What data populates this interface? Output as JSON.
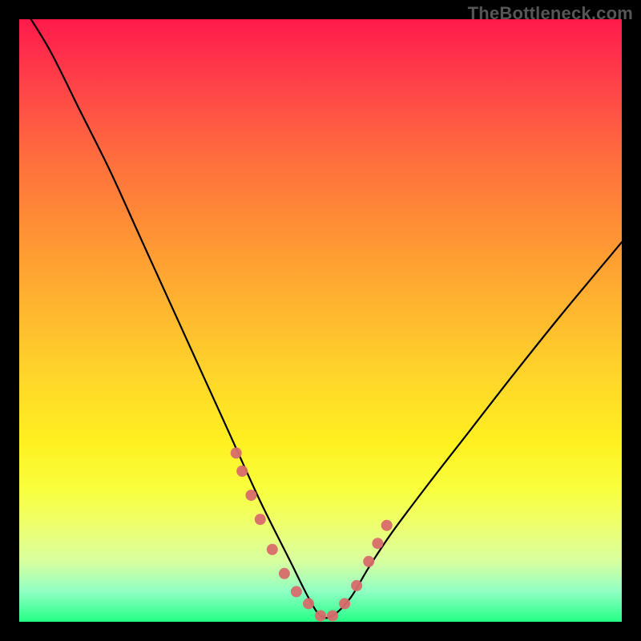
{
  "watermark": "TheBottleneck.com",
  "chart_data": {
    "type": "line",
    "title": "",
    "xlabel": "",
    "ylabel": "",
    "xlim": [
      0,
      100
    ],
    "ylim": [
      0,
      100
    ],
    "series": [
      {
        "name": "bottleneck-curve",
        "x": [
          0,
          5,
          10,
          15,
          20,
          25,
          30,
          35,
          40,
          45,
          48,
          50,
          52,
          55,
          58,
          62,
          68,
          75,
          82,
          90,
          100
        ],
        "values": [
          103,
          95,
          85,
          75,
          64,
          53,
          42,
          31,
          20,
          10,
          4,
          1,
          1,
          4,
          9,
          15,
          23,
          32,
          41,
          51,
          63
        ]
      }
    ],
    "markers": {
      "name": "highlight-dots",
      "color": "#d86b6b",
      "x": [
        36,
        37,
        38.5,
        40,
        42,
        44,
        46,
        48,
        50,
        52,
        54,
        56,
        58,
        59.5,
        61
      ],
      "values": [
        28,
        25,
        21,
        17,
        12,
        8,
        5,
        3,
        1,
        1,
        3,
        6,
        10,
        13,
        16
      ]
    }
  }
}
